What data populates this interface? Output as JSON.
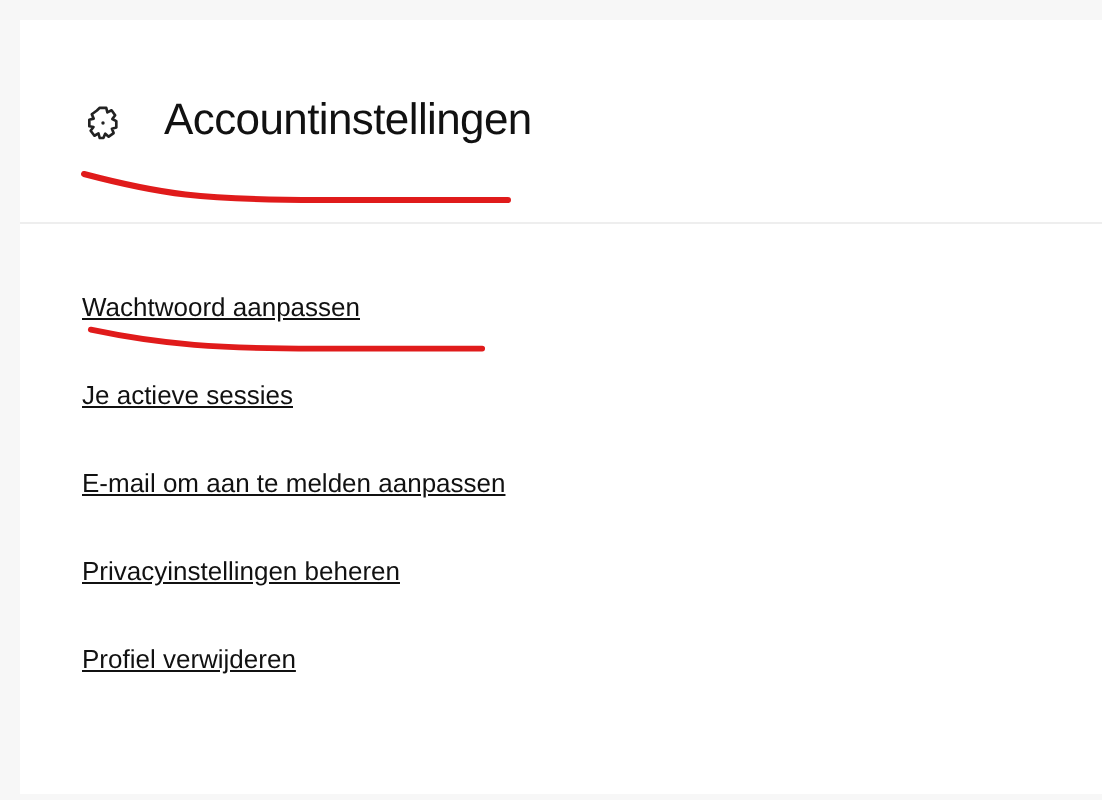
{
  "header": {
    "title": "Accountinstellingen",
    "red_underline": true
  },
  "links": [
    {
      "label": "Wachtwoord aanpassen",
      "red_underline": true
    },
    {
      "label": "Je actieve sessies",
      "red_underline": false
    },
    {
      "label": "E-mail om aan te melden aanpassen",
      "red_underline": false
    },
    {
      "label": "Privacyinstellingen beheren",
      "red_underline": false
    },
    {
      "label": "Profiel verwijderen",
      "red_underline": false
    }
  ]
}
